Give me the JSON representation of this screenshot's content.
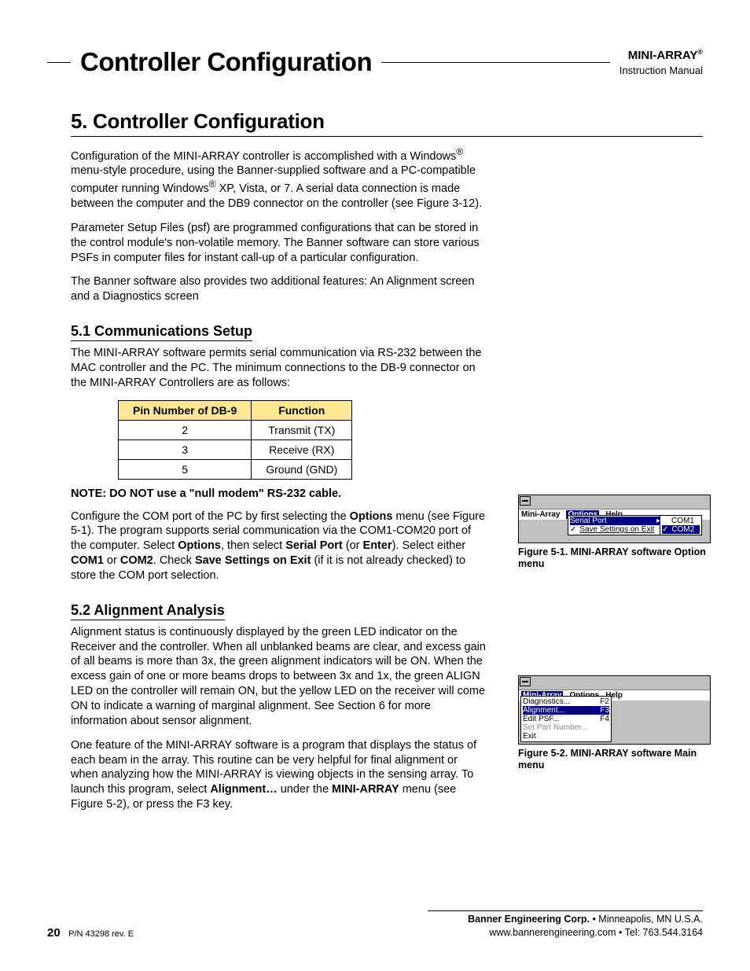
{
  "header": {
    "page_title": "Controller Configuration",
    "brand": "MINI-ARRAY",
    "brand_reg": "®",
    "subtitle": "Instruction Manual"
  },
  "section": {
    "heading": "5.  Controller Configuration",
    "p1a": "Configuration of the MINI-ARRAY controller is accomplished with a Windows",
    "p1b": " menu-style procedure, using the Banner-supplied software and a PC-compatible computer running Windows",
    "p1c": " XP, Vista, or 7. A serial data connection is made between the computer and the DB9 connector on the controller (see Figure 3-12).",
    "p2": "Parameter Setup Files (psf) are programmed configurations that can be stored in the control module's non-volatile memory. The Banner software can store various PSFs in computer files for instant call-up of a particular configuration.",
    "p3": "The Banner software also provides two additional features: An Alignment screen and a Diagnostics screen",
    "sub51": "5.1  Communications Setup",
    "p51": "The MINI-ARRAY software permits serial communication via RS-232 between the MAC controller and the PC. The minimum connections to the DB-9 connector on the MINI-ARRAY Controllers are as follows:",
    "table": {
      "h1": "Pin Number of DB-9",
      "h2": "Function",
      "rows": [
        {
          "pin": "2",
          "fn": "Transmit (TX)"
        },
        {
          "pin": "3",
          "fn": "Receive (RX)"
        },
        {
          "pin": "5",
          "fn": "Ground (GND)"
        }
      ]
    },
    "note": "NOTE: DO NOT use a \"null modem\" RS-232 cable.",
    "p52a": "Configure the COM port of the PC by first selecting the ",
    "p52b": "Options",
    "p52c": " menu (see Figure 5-1). The program supports serial communication via the COM1-COM20 port of the computer. Select ",
    "p52d": "Options",
    "p52e": ", then select ",
    "p52f": "Serial Port",
    "p52g": " (or ",
    "p52h": "Enter",
    "p52i": "). Select either ",
    "p52j": "COM1",
    "p52k": " or ",
    "p52l": "COM2",
    "p52m": ". Check ",
    "p52n": "Save Settings on Exit",
    "p52o": " (if it is not already checked) to store the COM port selection.",
    "sub52": "5.2  Alignment Analysis",
    "p53": "Alignment status is continuously displayed by the green LED indicator on the Receiver and the controller. When all unblanked beams are clear, and excess gain of all beams is more than 3x, the green alignment indicators will be ON. When the excess gain of one or more beams drops to between 3x and 1x, the green ALIGN LED on the controller will remain ON, but the yellow LED on the receiver will come ON to indicate a warning of marginal alignment. See Section 6 for more information about sensor alignment.",
    "p54a": "One feature of the MINI-ARRAY software is a program that displays the status of each beam in the array. This routine can be very helpful for final alignment or when analyzing how the MINI-ARRAY is viewing objects in the sensing array. To launch this program, select ",
    "p54b": "Alignment…",
    "p54c": " under the ",
    "p54d": "MINI-ARRAY",
    "p54e": " menu (see Figure 5-2), or press the F3 key."
  },
  "fig1": {
    "menu": {
      "m1": "Mini-Array",
      "m2": "Options",
      "m3": "Help",
      "d1": "Serial Port",
      "d2": "Save Settings on Exit",
      "s1": "COM1",
      "s2": "COM2"
    },
    "caption": "Figure 5-1.  MINI-ARRAY software Option menu"
  },
  "fig2": {
    "menu": {
      "m1": "Mini-Array",
      "m2": "Options",
      "m3": "Help",
      "r1a": "Diagnostics...",
      "r1b": "F2",
      "r2a": "Alignment...",
      "r2b": "F3",
      "r3a": "Edit PSF...",
      "r3b": "F4",
      "r4a": "Set Part Number...",
      "r5a": "Exit"
    },
    "caption": "Figure 5-2.  MINI-ARRAY software Main menu"
  },
  "footer": {
    "line1a": "Banner Engineering Corp.",
    "line1b": " • Minneapolis, MN U.S.A.",
    "line2": "www.bannerengineering.com  •  Tel: 763.544.3164",
    "page": "20",
    "pn": "P/N 43298 rev. E"
  }
}
